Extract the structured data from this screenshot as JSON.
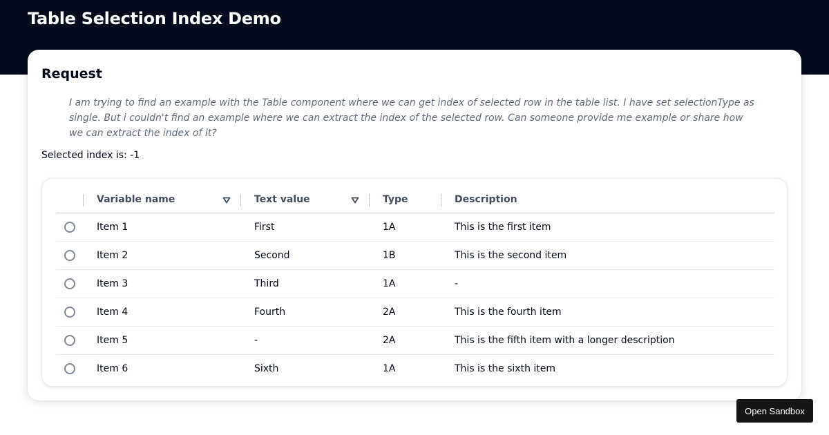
{
  "page": {
    "title": "Table Selection Index Demo"
  },
  "request": {
    "heading": "Request",
    "text": "I am trying to find an example with the Table component where we can get index of selected row in the table list. I have set selectionType as single. But i couldn't find an example where we can extract the index of the selected row. Can someone provide me example or share how we can extract the index of it?"
  },
  "selection": {
    "label": "Selected index is: ",
    "value": "-1"
  },
  "table": {
    "columns": [
      {
        "label": "Variable name",
        "sortable": true
      },
      {
        "label": "Text value",
        "sortable": true
      },
      {
        "label": "Type",
        "sortable": false
      },
      {
        "label": "Description",
        "sortable": false
      }
    ],
    "rows": [
      {
        "name": "Item 1",
        "value": "First",
        "type": "1A",
        "description": "This is the first item"
      },
      {
        "name": "Item 2",
        "value": "Second",
        "type": "1B",
        "description": "This is the second item"
      },
      {
        "name": "Item 3",
        "value": "Third",
        "type": "1A",
        "description": "-"
      },
      {
        "name": "Item 4",
        "value": "Fourth",
        "type": "2A",
        "description": "This is the fourth item"
      },
      {
        "name": "Item 5",
        "value": "-",
        "type": "2A",
        "description": "This is the fifth item with a longer description"
      },
      {
        "name": "Item 6",
        "value": "Sixth",
        "type": "1A",
        "description": "This is the sixth item"
      }
    ]
  },
  "sandbox": {
    "label": "Open Sandbox"
  },
  "colors": {
    "header_band": "#030b1d",
    "text_primary": "#000716",
    "text_muted": "#5f6b7a",
    "radio_border": "#7d8998",
    "sandbox_button": "#151515"
  }
}
